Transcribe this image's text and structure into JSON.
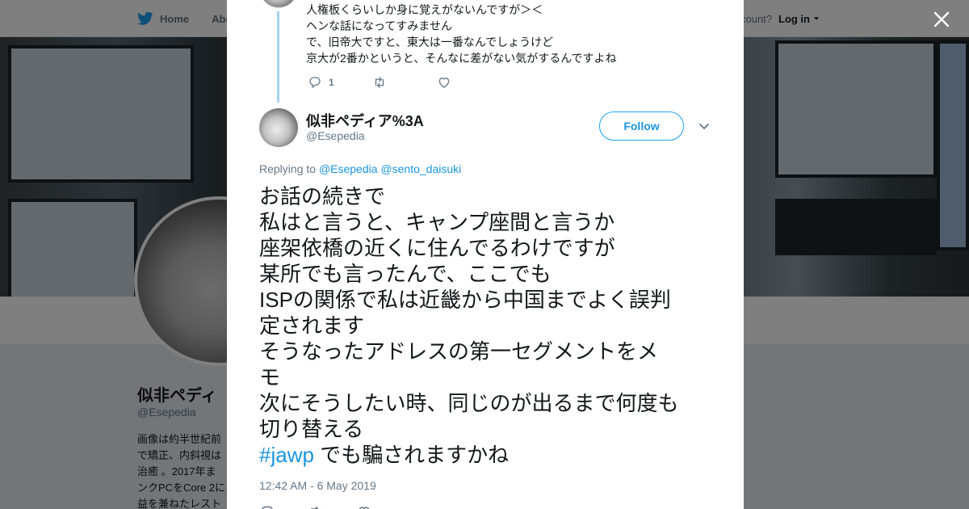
{
  "nav": {
    "home_label": "Home",
    "about_label": "Abo",
    "account_prompt": "ccount?",
    "login_label": "Log in"
  },
  "background_profile": {
    "name": "似非ペディ",
    "handle": "@Esepedia",
    "bio_lines": [
      "画像は約半世紀前",
      "で矯正、内斜視は",
      "治癒 。2017年ま",
      "ンクPCをCore 2に",
      "益を兼ねたレスト"
    ]
  },
  "parent_tweet": {
    "lines": [
      "人権板くらいしか身に覚えがないんですが＞＜",
      "ヘンな話になってすみません",
      "で、旧帝大ですと、東大は一番なんでしょうけど",
      "京大が2番かというと、そんなに差がない気がするんですよね"
    ],
    "reply_count": "1"
  },
  "tweet": {
    "author_name": "似非ペディア%3A",
    "author_handle": "@Esepedia",
    "follow_label": "Follow",
    "replying_prefix": "Replying to",
    "mention_1": "@Esepedia",
    "mention_2": "@sento_daisuki",
    "text_lines": [
      "お話の続きで",
      "私はと言うと、キャンプ座間と言うか",
      "座架依橋の近くに住んでるわけですが",
      "某所でも言ったんで、ここでも",
      "ISPの関係で私は近畿から中国までよく誤判",
      "定されます",
      "そうなったアドレスの第一セグメントをメ",
      "モ",
      "次にそうしたい時、同じのが出るまで何度も",
      "切り替える"
    ],
    "hashtag": "#jawp",
    "last_line_rest": " でも騙されますかね",
    "timestamp": "12:42 AM - 6 May 2019"
  },
  "colors": {
    "accent": "#1da1f2",
    "link": "#1b95e0",
    "text": "#14171a",
    "muted": "#657786",
    "thread_line": "#a6d3f0"
  },
  "icons": [
    "twitter-bird-icon",
    "close-icon",
    "reply-icon",
    "retweet-icon",
    "like-icon",
    "chevron-down-icon"
  ]
}
